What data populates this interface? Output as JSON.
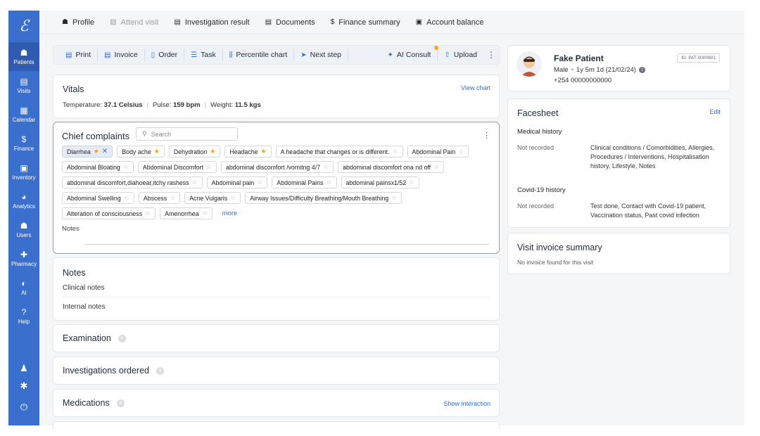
{
  "rail": {
    "logo": "ℰ",
    "items": [
      {
        "label": "Patients",
        "icon": "patients-icon",
        "glyph": "☗",
        "active": true
      },
      {
        "label": "Visits",
        "icon": "visits-icon",
        "glyph": "▤"
      },
      {
        "label": "Calendar",
        "icon": "calendar-icon",
        "glyph": "▦"
      },
      {
        "label": "Finance",
        "icon": "finance-icon",
        "glyph": "$"
      },
      {
        "label": "Inventory",
        "icon": "inventory-icon",
        "glyph": "▣"
      },
      {
        "label": "Analytics",
        "icon": "analytics-icon",
        "glyph": "◕"
      },
      {
        "label": "Users",
        "icon": "users-icon",
        "glyph": "☗"
      },
      {
        "label": "Pharmacy",
        "icon": "pharmacy-icon",
        "glyph": "✚"
      },
      {
        "label": "AI",
        "icon": "ai-icon",
        "glyph": "◐"
      },
      {
        "label": "Help",
        "icon": "help-icon",
        "glyph": "?"
      }
    ],
    "bottom": [
      {
        "icon": "notifications-icon",
        "glyph": "♟"
      },
      {
        "icon": "settings-icon",
        "glyph": "✱"
      },
      {
        "icon": "power-icon",
        "glyph": "⏻"
      }
    ]
  },
  "tabs": [
    {
      "label": "Profile",
      "icon": "profile-icon",
      "glyph": "☗"
    },
    {
      "label": "Attend visit",
      "icon": "attend-visit-icon",
      "glyph": "▧",
      "disabled": true
    },
    {
      "label": "Investigation result",
      "icon": "investigation-icon",
      "glyph": "▤"
    },
    {
      "label": "Documents",
      "icon": "documents-icon",
      "glyph": "▤"
    },
    {
      "label": "Finance summary",
      "icon": "finance-summary-icon",
      "glyph": "$"
    },
    {
      "label": "Account balance",
      "icon": "account-balance-icon",
      "glyph": "▣"
    }
  ],
  "toolbar": {
    "buttons": [
      {
        "label": "Print",
        "icon": "print-icon",
        "glyph": "▤"
      },
      {
        "label": "Invoice",
        "icon": "invoice-icon",
        "glyph": "▤"
      },
      {
        "label": "Order",
        "icon": "order-icon",
        "glyph": "▯"
      },
      {
        "label": "Task",
        "icon": "task-icon",
        "glyph": "☰"
      },
      {
        "label": "Percentile chart",
        "icon": "percentile-chart-icon",
        "glyph": "⫼"
      },
      {
        "label": "Next step",
        "icon": "next-step-icon",
        "glyph": "➤"
      }
    ],
    "ai_consult": {
      "label": "AI Consult",
      "glyph": "✦"
    },
    "upload": {
      "label": "Upload",
      "glyph": "⇧"
    }
  },
  "vitals": {
    "title": "Vitals",
    "link": "View chart",
    "items": [
      {
        "label": "Temperature:",
        "value": "37.1 Celsius"
      },
      {
        "label": "Pulse:",
        "value": "159 bpm"
      },
      {
        "label": "Weight:",
        "value": "11.5 kgs"
      }
    ]
  },
  "complaints": {
    "title": "Chief complaints",
    "search_placeholder": "Search",
    "chips": [
      {
        "label": "Diarrhea",
        "starred": true,
        "selected": true
      },
      {
        "label": "Body ache",
        "starred": true
      },
      {
        "label": "Dehydration",
        "starred": true
      },
      {
        "label": "Headache",
        "starred": true
      },
      {
        "label": "A headache that changes or is different.",
        "starred": false
      },
      {
        "label": "Abdominal Pain",
        "starred": false
      },
      {
        "label": "Abdominal Bloating",
        "starred": false
      },
      {
        "label": "Abdominal Discomfort",
        "starred": false
      },
      {
        "label": "abdominal discomfort /vomitng 4/7",
        "starred": false
      },
      {
        "label": "abdominal discomfort ona nd off",
        "starred": false
      },
      {
        "label": "abdominal discomfort,diahoear,itchy rashess",
        "starred": false
      },
      {
        "label": "Abdominal pain",
        "starred": false
      },
      {
        "label": "Abdominal Pains",
        "starred": false
      },
      {
        "label": "abdominal painsx1/52",
        "starred": false
      },
      {
        "label": "Abdominal Swelling",
        "starred": false
      },
      {
        "label": "Abscess",
        "starred": false
      },
      {
        "label": "Acne Vulgaris",
        "starred": false
      },
      {
        "label": "Airway Issues/Difficulty Breathing/Mouth Breathing",
        "starred": false
      },
      {
        "label": "Alteration of consciousness",
        "starred": false
      },
      {
        "label": "Amenorrhea",
        "starred": false
      }
    ],
    "more_label": "more",
    "notes_label": "Notes"
  },
  "notes": {
    "title": "Notes",
    "clinical": "Clinical notes",
    "internal": "Internal notes"
  },
  "sections": {
    "examination": "Examination",
    "investigations": "Investigations ordered",
    "medications": "Medications",
    "show_interaction": "Show interaction"
  },
  "patient": {
    "name": "Fake Patient",
    "id": "ID: PAT-0000801",
    "sex": "Male",
    "age": "1y 5m 1d (21/02/24)",
    "phone": "+254 00000000000"
  },
  "facesheet": {
    "title": "Facesheet",
    "edit": "Edit",
    "medical_history": {
      "heading": "Medical history",
      "status": "Not recorded",
      "detail": "Clinical conditions / Comorbidities, Allergies, Procedures / Interventions, Hospitalisation history, Lifestyle, Notes"
    },
    "covid_history": {
      "heading": "Covid-19 history",
      "status": "Not recorded",
      "detail": "Test done, Contact with Covid-19 patient, Vaccination status, Past covid infection"
    }
  },
  "invoice": {
    "title": "Visit invoice summary",
    "empty": "No invoice found for this visit"
  },
  "colors": {
    "rail": "#3b6fce",
    "accent": "#2f6fd6",
    "star": "#f0a020"
  }
}
